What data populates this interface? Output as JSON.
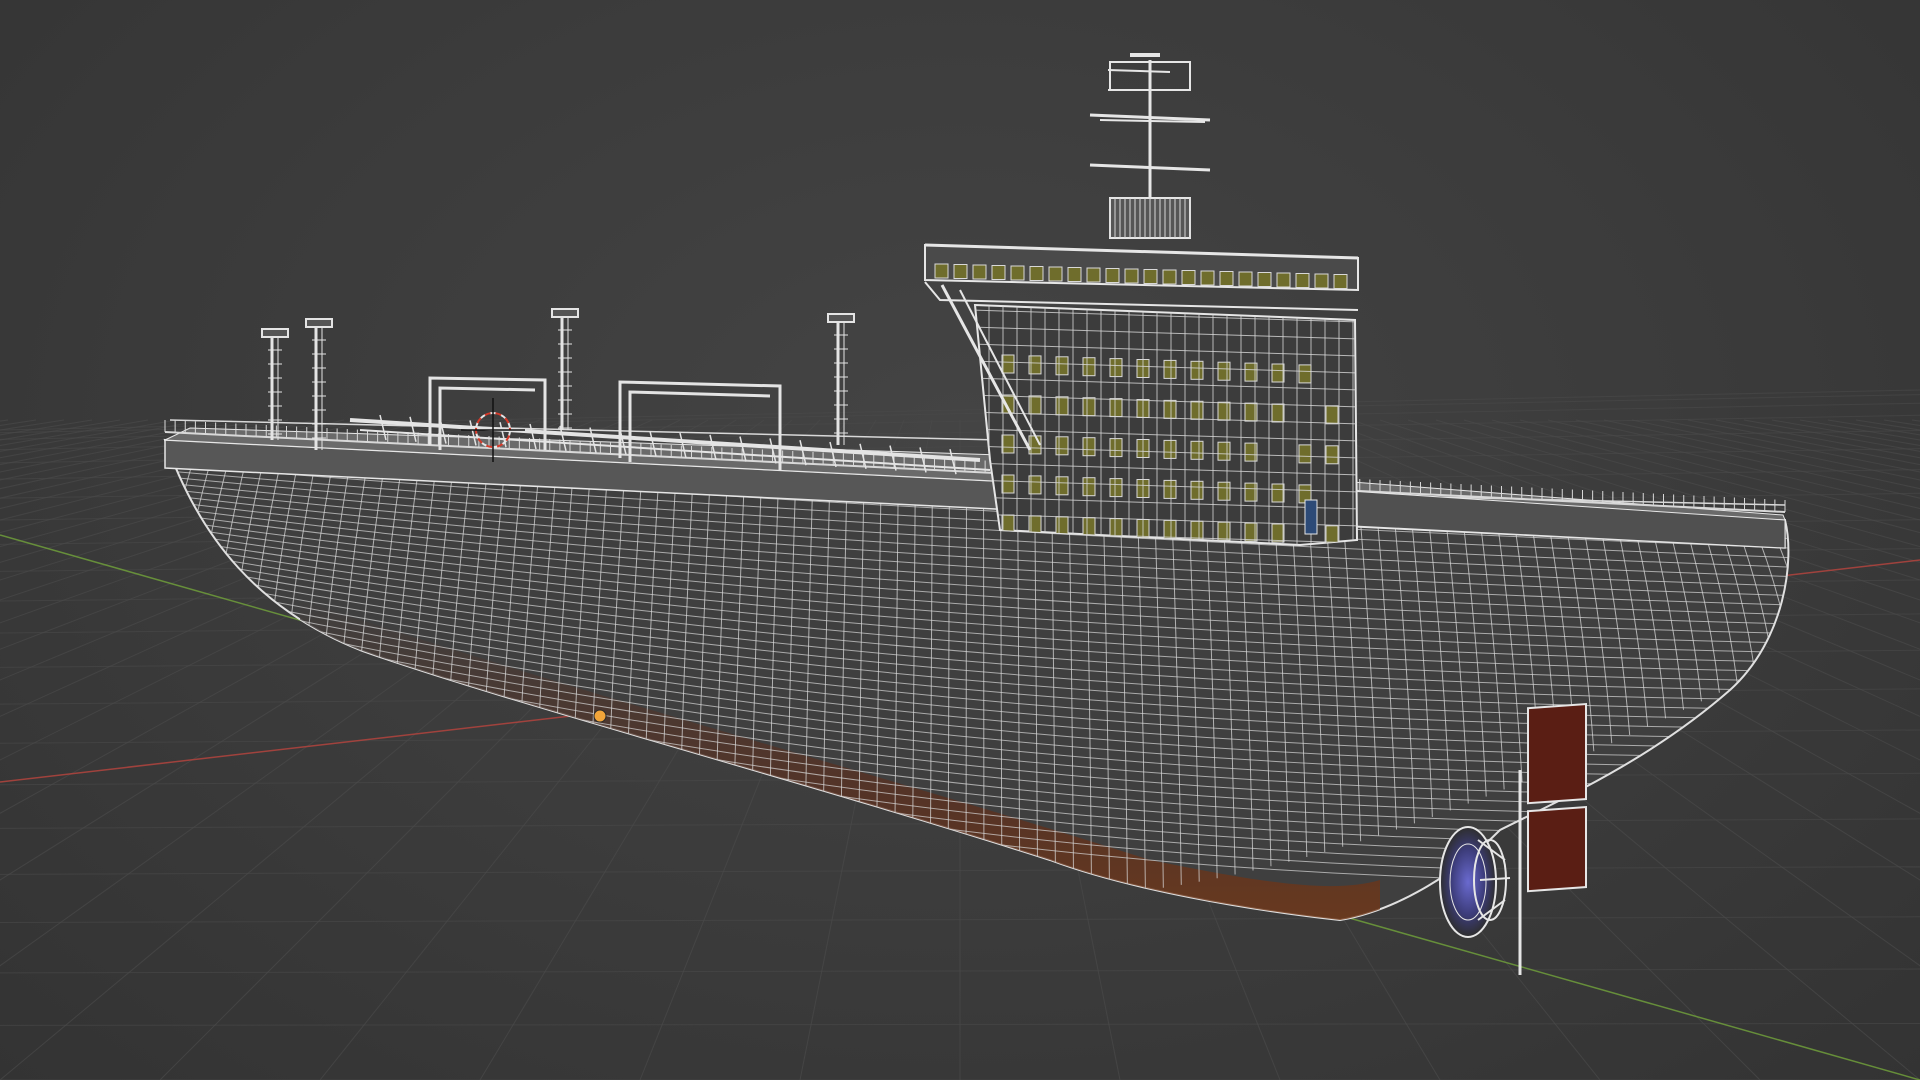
{
  "viewport": {
    "mode": "wireframe",
    "background_color": "#3d3d3d",
    "grid_color": "#4a4a4a",
    "x_axis_color": "#b3443e",
    "y_axis_color": "#6f9e3b"
  },
  "model": {
    "name_icon": "tanker-ship-wireframe",
    "wire_color": "#d8d8d8",
    "hull_color": "#3f3f3f",
    "antifouling_color": "#7a3a14",
    "window_color": "#6f6d2c",
    "rudder_color": "#5a1e14",
    "propeller_color": "#4a4a9a"
  },
  "markers": {
    "origin_dot_icon": "object-origin-icon",
    "origin_dot_color": "#f2a53a",
    "cursor_icon": "3d-cursor-icon"
  }
}
